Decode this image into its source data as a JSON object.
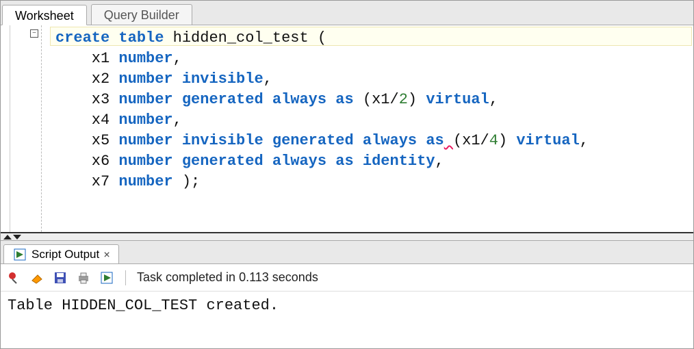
{
  "tabs": {
    "active": "Worksheet",
    "inactive": "Query Builder"
  },
  "code": {
    "tokens": [
      [
        [
          "create",
          "kw"
        ],
        [
          " ",
          ""
        ],
        [
          "table",
          "kw"
        ],
        [
          " ",
          ""
        ],
        [
          "hidden_col_test",
          "id"
        ],
        [
          " ",
          ""
        ],
        [
          "(",
          "id"
        ]
      ],
      [
        [
          "    x1 ",
          "id"
        ],
        [
          "number",
          "kw"
        ],
        [
          ",",
          "id"
        ]
      ],
      [
        [
          "    x2 ",
          "id"
        ],
        [
          "number",
          "kw"
        ],
        [
          " ",
          ""
        ],
        [
          "invisible",
          "kw"
        ],
        [
          ",",
          "id"
        ]
      ],
      [
        [
          "    x3 ",
          "id"
        ],
        [
          "number",
          "kw"
        ],
        [
          " ",
          ""
        ],
        [
          "generated",
          "kw"
        ],
        [
          " ",
          ""
        ],
        [
          "always",
          "kw"
        ],
        [
          " ",
          ""
        ],
        [
          "as",
          "kw"
        ],
        [
          " ",
          ""
        ],
        [
          "(",
          "id"
        ],
        [
          "x1",
          "id"
        ],
        [
          "/",
          "id"
        ],
        [
          "2",
          "num"
        ],
        [
          ")",
          "id"
        ],
        [
          " ",
          ""
        ],
        [
          "virtual",
          "kw"
        ],
        [
          ",",
          "id"
        ]
      ],
      [
        [
          "    x4 ",
          "id"
        ],
        [
          "number",
          "kw"
        ],
        [
          ",",
          "id"
        ]
      ],
      [
        [
          "    x5 ",
          "id"
        ],
        [
          "number",
          "kw"
        ],
        [
          " ",
          ""
        ],
        [
          "invisible",
          "kw"
        ],
        [
          " ",
          ""
        ],
        [
          "generated",
          "kw"
        ],
        [
          " ",
          ""
        ],
        [
          "always",
          "kw"
        ],
        [
          " ",
          ""
        ],
        [
          "as",
          "kw"
        ],
        [
          " ",
          "squiggle"
        ],
        [
          "(",
          "id"
        ],
        [
          "x1",
          "id"
        ],
        [
          "/",
          "id"
        ],
        [
          "4",
          "num"
        ],
        [
          ")",
          "id"
        ],
        [
          " ",
          ""
        ],
        [
          "virtual",
          "kw"
        ],
        [
          ",",
          "id"
        ]
      ],
      [
        [
          "    x6 ",
          "id"
        ],
        [
          "number",
          "kw"
        ],
        [
          " ",
          ""
        ],
        [
          "generated",
          "kw"
        ],
        [
          " ",
          ""
        ],
        [
          "always",
          "kw"
        ],
        [
          " ",
          ""
        ],
        [
          "as",
          "kw"
        ],
        [
          " ",
          ""
        ],
        [
          "identity",
          "kw"
        ],
        [
          ",",
          "id"
        ]
      ],
      [
        [
          "    x7 ",
          "id"
        ],
        [
          "number",
          "kw"
        ],
        [
          " ",
          ""
        ],
        [
          ");",
          "id"
        ]
      ]
    ]
  },
  "output_tab": {
    "label": "Script Output",
    "close": "×"
  },
  "toolbar": {
    "status": "Task completed in 0.113 seconds"
  },
  "output_body": "Table HIDDEN_COL_TEST created."
}
